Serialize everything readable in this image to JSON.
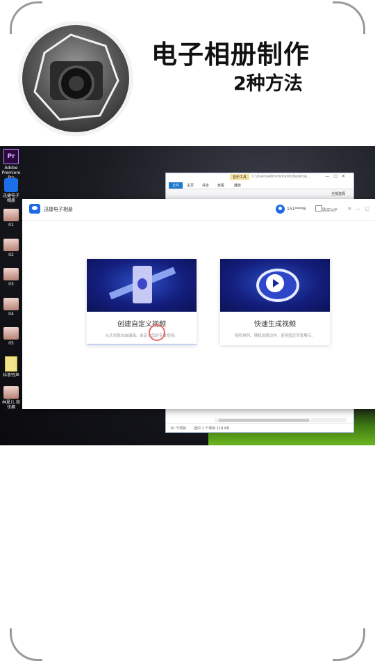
{
  "header": {
    "title": "电子相册制作",
    "subtitle": "2种方法"
  },
  "desktop": {
    "icons": [
      {
        "label": "Adobe Premiere Pro",
        "kind": "pr",
        "glyph": "Pr"
      },
      {
        "label": "迅捷电子相册",
        "kind": "app"
      },
      {
        "label": "01",
        "kind": "photo"
      },
      {
        "label": "02",
        "kind": "photo"
      },
      {
        "label": "03",
        "kind": "photo"
      },
      {
        "label": "04",
        "kind": "photo"
      },
      {
        "label": "05",
        "kind": "photo"
      },
      {
        "label": "抖音铃声",
        "kind": "file"
      },
      {
        "label": "林夏儿 我也拥",
        "kind": "photo"
      }
    ]
  },
  "explorer": {
    "music_tool_tab": "音乐工具",
    "path": "C:\\Users\\Administrator\\Desktop...",
    "tabs": [
      "文件",
      "主页",
      "共享",
      "查看",
      "播放"
    ],
    "select_all": "全部选择",
    "status_count": "10 个项目",
    "status_selected": "选中 1 个项目  119 KB"
  },
  "app": {
    "name": "迅捷电子相册",
    "user_id": "151****8",
    "vip_label": "购买VIP",
    "cards": [
      {
        "title": "创建自定义视频",
        "desc": "从头到尾自由编辑。自定义您的专属视频。"
      },
      {
        "title": "快速生成视频",
        "desc": "随机排列、随机选择动作，使用固定背景展示。"
      }
    ]
  }
}
